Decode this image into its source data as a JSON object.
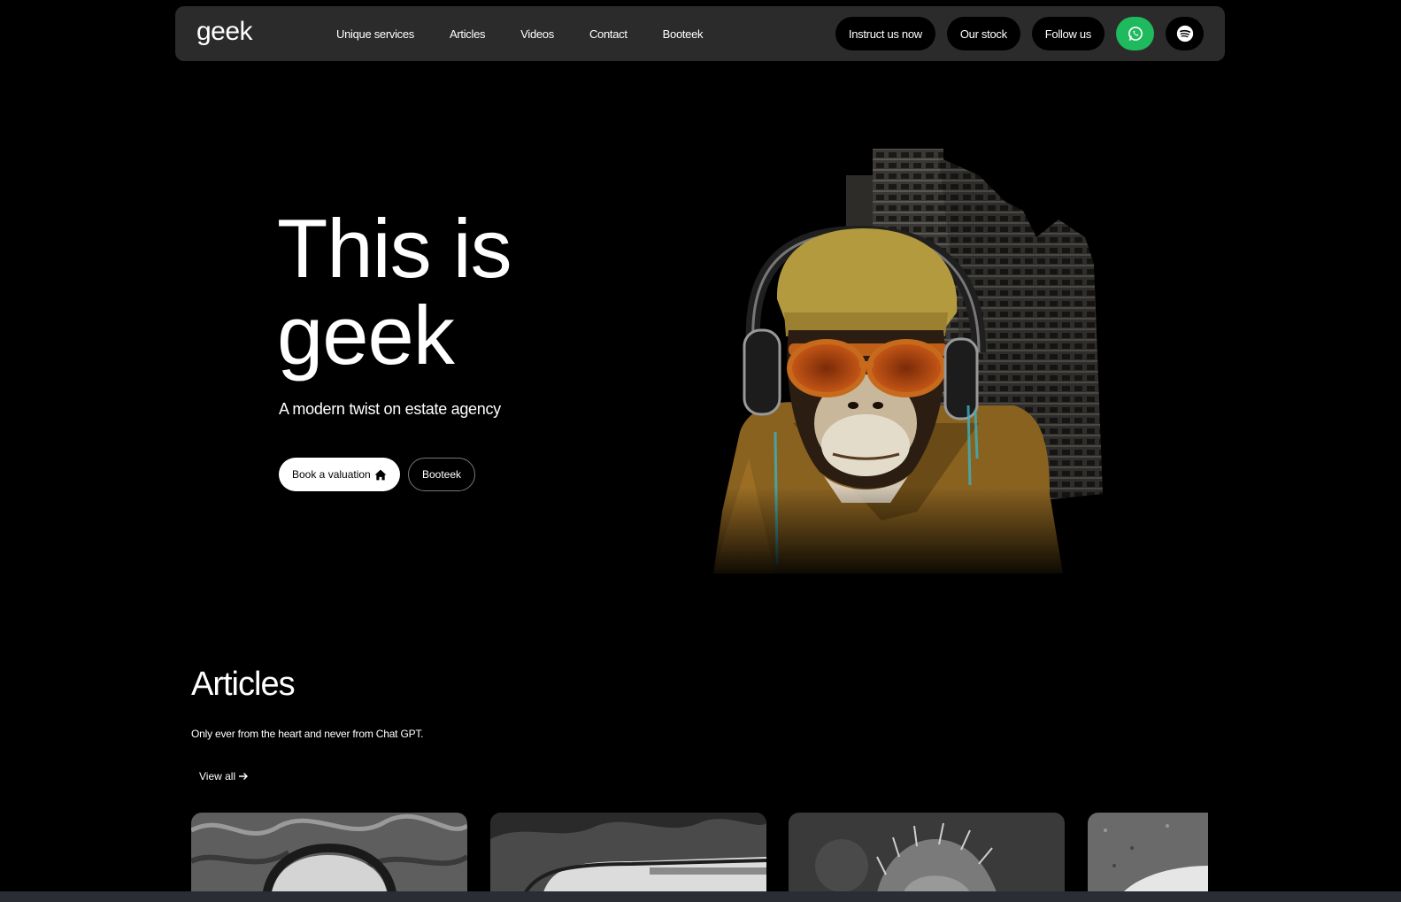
{
  "nav": {
    "logo": "geek",
    "links": [
      "Unique services",
      "Articles",
      "Videos",
      "Contact",
      "Booteek"
    ],
    "buttons": [
      "Instruct us now",
      "Our stock",
      "Follow us"
    ],
    "whatsapp_icon": "whatsapp-icon",
    "spotify_icon": "spotify-icon"
  },
  "hero": {
    "title_line1": "This is",
    "title_line2": "geek",
    "subtitle": "A modern twist on estate agency",
    "primary_button": "Book a valuation",
    "secondary_button": "Booteek",
    "image_description_icon": "monkey-illustration"
  },
  "articles": {
    "title": "Articles",
    "subtitle": "Only ever from the heart and never from Chat GPT.",
    "view_all": "View all",
    "cards": [
      "article-card-1",
      "article-card-2",
      "article-card-3",
      "article-card-4"
    ]
  },
  "colors": {
    "background": "#000000",
    "nav_bg": "#2b2b2b",
    "whatsapp": "#1fba5d",
    "accent_orange": "#d97a1c"
  }
}
